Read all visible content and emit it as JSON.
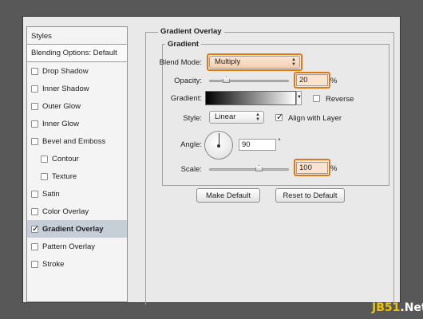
{
  "styles_panel": {
    "title": "Styles",
    "blending_options": "Blending Options: Default",
    "items": [
      {
        "label": "Drop Shadow",
        "checked": false,
        "indent": false,
        "selected": false
      },
      {
        "label": "Inner Shadow",
        "checked": false,
        "indent": false,
        "selected": false
      },
      {
        "label": "Outer Glow",
        "checked": false,
        "indent": false,
        "selected": false
      },
      {
        "label": "Inner Glow",
        "checked": false,
        "indent": false,
        "selected": false
      },
      {
        "label": "Bevel and Emboss",
        "checked": false,
        "indent": false,
        "selected": false
      },
      {
        "label": "Contour",
        "checked": false,
        "indent": true,
        "selected": false
      },
      {
        "label": "Texture",
        "checked": false,
        "indent": true,
        "selected": false
      },
      {
        "label": "Satin",
        "checked": false,
        "indent": false,
        "selected": false
      },
      {
        "label": "Color Overlay",
        "checked": false,
        "indent": false,
        "selected": false
      },
      {
        "label": "Gradient Overlay",
        "checked": true,
        "indent": false,
        "selected": true
      },
      {
        "label": "Pattern Overlay",
        "checked": false,
        "indent": false,
        "selected": false
      },
      {
        "label": "Stroke",
        "checked": false,
        "indent": false,
        "selected": false
      }
    ]
  },
  "gradient_overlay": {
    "section_title": "Gradient Overlay",
    "subsection_title": "Gradient",
    "blend_mode_label": "Blend Mode:",
    "blend_mode_value": "Multiply",
    "opacity_label": "Opacity:",
    "opacity_value": "20",
    "opacity_unit": "%",
    "gradient_label": "Gradient:",
    "gradient_start_color": "#000000",
    "gradient_end_color": "#ffffff",
    "reverse_label": "Reverse",
    "reverse_checked": false,
    "style_label": "Style:",
    "style_value": "Linear",
    "align_label": "Align with Layer",
    "align_checked": true,
    "angle_label": "Angle:",
    "angle_value": "90",
    "angle_unit": "°",
    "scale_label": "Scale:",
    "scale_value": "100",
    "scale_unit": "%",
    "make_default": "Make Default",
    "reset_default": "Reset to Default"
  },
  "highlight_color": "#e07a10",
  "watermark": {
    "prefix": "JB51",
    "suffix": ".Net"
  }
}
